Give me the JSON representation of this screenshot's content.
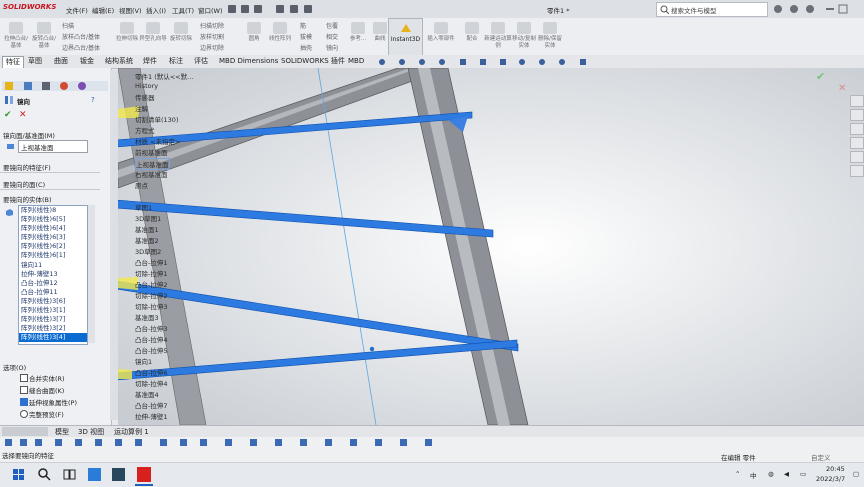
{
  "app": {
    "logo": "SOLIDWORKS",
    "doc_title": "零件1 *"
  },
  "menu": [
    "文件(F)",
    "编辑(E)",
    "视图(V)",
    "插入(I)",
    "工具(T)",
    "窗口(W)"
  ],
  "search": {
    "placeholder": "搜索文件与模型"
  },
  "ribbon": {
    "left_labels": [
      "拉伸凸台/基体",
      "旋转凸台/基体",
      "扫描",
      "放样凸台/基体",
      "边界凸台/基体"
    ],
    "cut_labels": [
      "拉伸切除",
      "异型孔向导",
      "旋转切除",
      "扫描切除",
      "放样切割",
      "边界切除"
    ],
    "big": [
      "圆角",
      "线性阵列",
      "筋",
      "拔模",
      "抽壳",
      "包覆",
      "相交",
      "镜向",
      "参考...",
      "曲线",
      "Instant3D",
      "插入零部件",
      "配合",
      "新建运动算例",
      "移动/复制实体",
      "删除/保留实体"
    ],
    "instant3d": "Instant3D"
  },
  "tabs": [
    "特征",
    "草图",
    "曲面",
    "钣金",
    "结构系统",
    "焊件",
    "标注",
    "评估",
    "MBD Dimensions",
    "SOLIDWORKS 插件",
    "MBD"
  ],
  "property_manager": {
    "title": "镜向",
    "mirror_face_label": "镜向面/基准面(M)",
    "mirror_face_value": "上视基准面",
    "features_label": "要镜向的特征(F)",
    "faces_label": "要镜向的面(C)",
    "bodies_label": "要镜向的实体(B)",
    "bodies": [
      "阵列(线性)8",
      "阵列(线性)6[5]",
      "阵列(线性)6[4]",
      "阵列(线性)6[3]",
      "阵列(线性)6[2]",
      "阵列(线性)6[1]",
      "镜向11",
      "拉伸-薄壁13",
      "凸台-拉伸12",
      "凸台-拉伸11",
      "阵列(线性)3[6]",
      "阵列(线性)3[1]",
      "阵列(线性)3[7]",
      "阵列(线性)3[2]",
      "阵列(线性)3[4]"
    ],
    "options_label": "选项(O)",
    "opt_merge": "合并实体(R)",
    "opt_knit": "缝合曲面(K)",
    "opt_propagate": "延伸视象属性(P)",
    "opt_full_preview": "完整预览(F)"
  },
  "feature_tree": [
    "零件1 (默认<<默...",
    "History",
    "传感器",
    "注解",
    "切割清单(130)",
    "方程式",
    "材质 <未指定>",
    "前视基准面",
    "上视基准面",
    "右视基准面",
    "原点",
    "草图1",
    "3D草图1",
    "基准面1",
    "基准面2",
    "3D草图2",
    "凸台-拉伸1",
    "切除-拉伸1",
    "凸台-拉伸2",
    "切除-拉伸2",
    "切除-拉伸3",
    "基准面3",
    "凸台-拉伸3",
    "凸台-拉伸4",
    "凸台-拉伸5",
    "镜向1",
    "凸台-拉伸6",
    "切除-拉伸4",
    "基准面4",
    "凸台-拉伸7",
    "拉伸-薄壁1",
    "切除-拉伸5",
    "凸台-拉伸8"
  ],
  "bottom_tabs": [
    "模型",
    "3D 视图",
    "运动算例 1"
  ],
  "status": {
    "left": "选择要镜向的特征",
    "editing": "在编辑 零件",
    "custom": "自定义"
  },
  "taskbar": {
    "time": "20:45",
    "date": "2022/3/7",
    "ime": "中"
  }
}
